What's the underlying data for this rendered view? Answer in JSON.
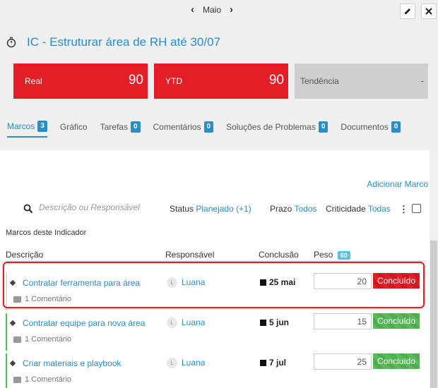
{
  "topbar": {
    "month": "Maio",
    "prev_icon": "chevron-left-icon",
    "next_icon": "chevron-right-icon",
    "edit_icon": "pencil-icon",
    "close_icon": "close-icon"
  },
  "indicator": {
    "title": "IC - Estruturar área de RH até 30/07",
    "icon": "stopwatch-icon"
  },
  "cards": {
    "real": {
      "label": "Real",
      "value": "90",
      "color": "#e31e26"
    },
    "ytd": {
      "label": "YTD",
      "value": "90",
      "color": "#e31e26"
    },
    "tendencia": {
      "label": "Tendência",
      "value": "-",
      "color": "#cfcfcf"
    }
  },
  "tabs": [
    {
      "label": "Marcos",
      "count": "3"
    },
    {
      "label": "Gráfico",
      "count": ""
    },
    {
      "label": "Tarefas",
      "count": "0"
    },
    {
      "label": "Comentários",
      "count": "0"
    },
    {
      "label": "Soluções de Problemas",
      "count": "0"
    },
    {
      "label": "Documentos",
      "count": "0"
    }
  ],
  "marcos": {
    "add_label": "Adicionar Marco",
    "search_placeholder": "Descrição ou Responsável",
    "filters": {
      "status_label": "Status",
      "status_value": "Planejado (+1)",
      "prazo_label": "Prazo",
      "prazo_value": "Todos",
      "criticidade_label": "Criticidade",
      "criticidade_value": "Todas"
    },
    "section_label": "Marcos deste Indicador",
    "columns": {
      "descricao": "Descrição",
      "responsavel": "Responsável",
      "conclusao": "Conclusão",
      "peso": "Peso",
      "peso_total": "60"
    },
    "rows": [
      {
        "descricao": "Contratar ferramenta para área",
        "comentarios": "1 Comentário",
        "avatar": "L",
        "responsavel": "Luana",
        "conclusao": "25 mai",
        "peso": "20",
        "status": "Concluído",
        "status_color": "#e31e26"
      },
      {
        "descricao": "Contratar equipe para nova área",
        "comentarios": "1 Comentário",
        "avatar": "L",
        "responsavel": "Luana",
        "conclusao": "5 jun",
        "peso": "15",
        "status": "Concluído",
        "status_color": "#5cb85c"
      },
      {
        "descricao": "Criar materiais e playbook",
        "comentarios": "1 Comentário",
        "avatar": "L",
        "responsavel": "Luana",
        "conclusao": "7 jul",
        "peso": "25",
        "status": "Concluído",
        "status_color": "#5cb85c"
      }
    ]
  }
}
